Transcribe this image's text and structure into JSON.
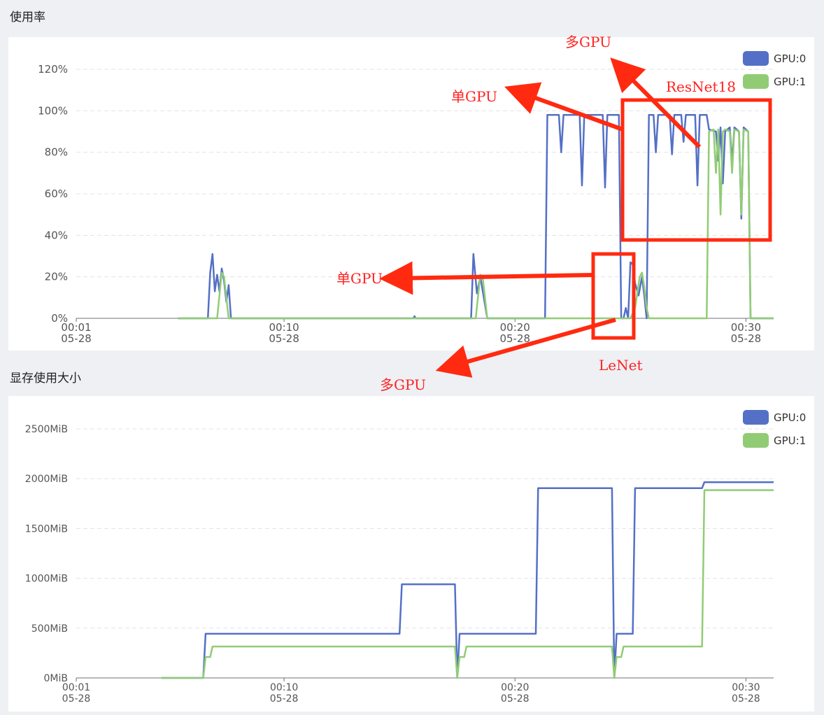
{
  "sections": {
    "util_title": "使用率",
    "mem_title": "显存使用大小"
  },
  "colors": {
    "gpu0": "#5470c6",
    "gpu1": "#91cc75",
    "annotation": "#ff2a10",
    "grid": "#e3e3e3"
  },
  "annotations": {
    "multi_gpu_top": "多GPU",
    "single_gpu_top": "单GPU",
    "resnet": "ResNet18",
    "single_gpu_low": "单GPU",
    "lenet": "LeNet",
    "multi_gpu_low": "多GPU"
  },
  "chart_data": [
    {
      "type": "line",
      "title": "使用率",
      "legend": [
        "GPU:0",
        "GPU:1"
      ],
      "legend_position": "top-right",
      "y_ticks": [
        "0%",
        "20%",
        "40%",
        "60%",
        "80%",
        "100%",
        "120%"
      ],
      "ylim": [
        0,
        120
      ],
      "xlim": [
        1,
        31.2
      ],
      "x_ticks": [
        {
          "x": 1,
          "time": "00:01",
          "date": "05-28"
        },
        {
          "x": 10,
          "time": "00:10",
          "date": "05-28"
        },
        {
          "x": 20,
          "time": "00:20",
          "date": "05-28"
        },
        {
          "x": 30,
          "time": "00:30",
          "date": "05-28"
        }
      ],
      "x_unit": "minutes after 00:00 on 05-28",
      "grid": true,
      "series": [
        {
          "name": "GPU:0",
          "color": "#5470c6",
          "points": [
            [
              5.4,
              0
            ],
            [
              6.7,
              0
            ],
            [
              6.8,
              22
            ],
            [
              6.9,
              31
            ],
            [
              7.0,
              13
            ],
            [
              7.1,
              21
            ],
            [
              7.2,
              13
            ],
            [
              7.3,
              24
            ],
            [
              7.4,
              18
            ],
            [
              7.5,
              8
            ],
            [
              7.6,
              16
            ],
            [
              7.7,
              0
            ],
            [
              15.6,
              0
            ],
            [
              15.65,
              1
            ],
            [
              15.7,
              0
            ],
            [
              18.1,
              0
            ],
            [
              18.2,
              31
            ],
            [
              18.35,
              12
            ],
            [
              18.5,
              20
            ],
            [
              18.8,
              0
            ],
            [
              21.3,
              0
            ],
            [
              21.4,
              98
            ],
            [
              21.9,
              98
            ],
            [
              22.0,
              80
            ],
            [
              22.1,
              98
            ],
            [
              22.8,
              98
            ],
            [
              22.9,
              64
            ],
            [
              23.0,
              98
            ],
            [
              23.8,
              98
            ],
            [
              23.9,
              63
            ],
            [
              24.0,
              98
            ],
            [
              24.5,
              98
            ],
            [
              24.6,
              0
            ],
            [
              24.7,
              0
            ],
            [
              24.8,
              5
            ],
            [
              24.9,
              0
            ],
            [
              25.0,
              27
            ],
            [
              25.1,
              26
            ],
            [
              25.2,
              17
            ],
            [
              25.35,
              11
            ],
            [
              25.5,
              20
            ],
            [
              25.6,
              11
            ],
            [
              25.7,
              0
            ],
            [
              25.8,
              98
            ],
            [
              26.0,
              98
            ],
            [
              26.1,
              80
            ],
            [
              26.2,
              98
            ],
            [
              26.7,
              98
            ],
            [
              26.8,
              79
            ],
            [
              26.9,
              98
            ],
            [
              27.2,
              98
            ],
            [
              27.3,
              85
            ],
            [
              27.4,
              98
            ],
            [
              27.8,
              98
            ],
            [
              27.9,
              64
            ],
            [
              28.0,
              98
            ],
            [
              28.3,
              98
            ],
            [
              28.4,
              91
            ],
            [
              28.7,
              90
            ],
            [
              28.8,
              76
            ],
            [
              28.9,
              92
            ],
            [
              29.0,
              65
            ],
            [
              29.1,
              90
            ],
            [
              29.3,
              92
            ],
            [
              29.4,
              75
            ],
            [
              29.5,
              92
            ],
            [
              29.7,
              90
            ],
            [
              29.8,
              48
            ],
            [
              29.9,
              92
            ],
            [
              30.1,
              90
            ],
            [
              30.2,
              0
            ],
            [
              31.2,
              0
            ]
          ]
        },
        {
          "name": "GPU:1",
          "color": "#91cc75",
          "points": [
            [
              5.4,
              0
            ],
            [
              7.1,
              0
            ],
            [
              7.3,
              22
            ],
            [
              7.4,
              20
            ],
            [
              7.6,
              0
            ],
            [
              18.3,
              0
            ],
            [
              18.5,
              21
            ],
            [
              18.6,
              20
            ],
            [
              18.8,
              0
            ],
            [
              25.0,
              0
            ],
            [
              25.2,
              5
            ],
            [
              25.4,
              20
            ],
            [
              25.5,
              22
            ],
            [
              25.6,
              15
            ],
            [
              25.7,
              5
            ],
            [
              25.8,
              0
            ],
            [
              28.3,
              0
            ],
            [
              28.4,
              90
            ],
            [
              28.6,
              91
            ],
            [
              28.7,
              70
            ],
            [
              28.8,
              91
            ],
            [
              28.9,
              50
            ],
            [
              29.0,
              90
            ],
            [
              29.1,
              91
            ],
            [
              29.3,
              90
            ],
            [
              29.4,
              70
            ],
            [
              29.5,
              91
            ],
            [
              29.7,
              90
            ],
            [
              29.8,
              50
            ],
            [
              29.9,
              91
            ],
            [
              30.1,
              90
            ],
            [
              30.2,
              0
            ],
            [
              31.2,
              0
            ]
          ]
        }
      ]
    },
    {
      "type": "line",
      "title": "显存使用大小",
      "legend": [
        "GPU:0",
        "GPU:1"
      ],
      "legend_position": "top-right",
      "y_ticks": [
        "0MiB",
        "500MiB",
        "1000MiB",
        "1500MiB",
        "2000MiB",
        "2500MiB"
      ],
      "ylim": [
        0,
        2500
      ],
      "xlim": [
        1,
        31.2
      ],
      "x_ticks": [
        {
          "x": 1,
          "time": "00:01",
          "date": "05-28"
        },
        {
          "x": 10,
          "time": "00:10",
          "date": "05-28"
        },
        {
          "x": 20,
          "time": "00:20",
          "date": "05-28"
        },
        {
          "x": 30,
          "time": "00:30",
          "date": "05-28"
        }
      ],
      "x_unit": "minutes after 00:00 on 05-28",
      "grid": true,
      "series": [
        {
          "name": "GPU:0",
          "color": "#5470c6",
          "points": [
            [
              4.7,
              0
            ],
            [
              6.5,
              0
            ],
            [
              6.6,
              443
            ],
            [
              15.0,
              443
            ],
            [
              15.1,
              940
            ],
            [
              17.4,
              940
            ],
            [
              17.5,
              0
            ],
            [
              17.6,
              443
            ],
            [
              20.9,
              443
            ],
            [
              21.0,
              1905
            ],
            [
              24.2,
              1905
            ],
            [
              24.3,
              0
            ],
            [
              24.4,
              443
            ],
            [
              25.1,
              443
            ],
            [
              25.2,
              1905
            ],
            [
              28.1,
              1905
            ],
            [
              28.2,
              1965
            ],
            [
              31.2,
              1965
            ]
          ]
        },
        {
          "name": "GPU:1",
          "color": "#91cc75",
          "points": [
            [
              4.7,
              0
            ],
            [
              6.5,
              0
            ],
            [
              6.6,
              210
            ],
            [
              6.8,
              210
            ],
            [
              6.9,
              315
            ],
            [
              17.4,
              315
            ],
            [
              17.5,
              0
            ],
            [
              17.6,
              210
            ],
            [
              17.8,
              210
            ],
            [
              17.9,
              315
            ],
            [
              24.2,
              315
            ],
            [
              24.3,
              0
            ],
            [
              24.4,
              210
            ],
            [
              24.6,
              210
            ],
            [
              24.7,
              315
            ],
            [
              28.1,
              315
            ],
            [
              28.2,
              1885
            ],
            [
              31.2,
              1885
            ]
          ]
        }
      ]
    }
  ]
}
